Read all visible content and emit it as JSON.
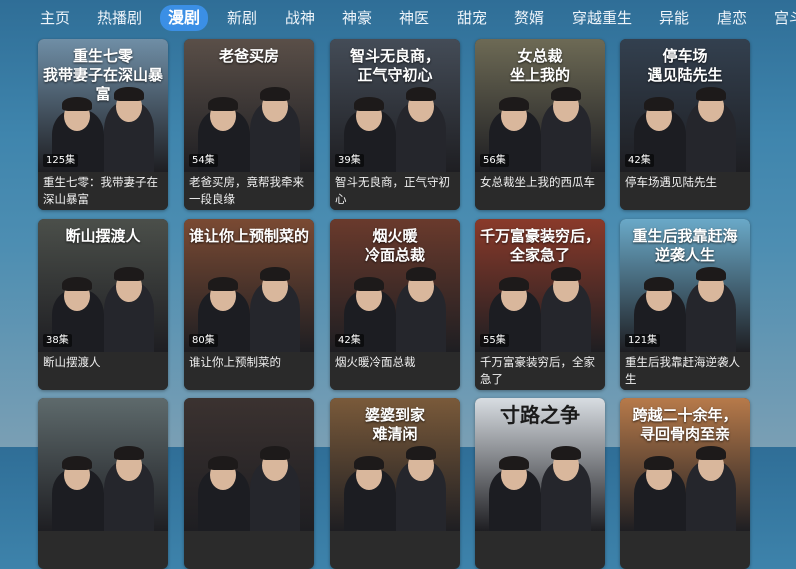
{
  "nav": {
    "tabs": [
      {
        "label": "主页",
        "active": false
      },
      {
        "label": "热播剧",
        "active": false
      },
      {
        "label": "漫剧",
        "active": true
      },
      {
        "label": "新剧",
        "active": false
      },
      {
        "label": "战神",
        "active": false
      },
      {
        "label": "神豪",
        "active": false
      },
      {
        "label": "神医",
        "active": false
      },
      {
        "label": "甜宠",
        "active": false
      },
      {
        "label": "赘婿",
        "active": false
      },
      {
        "label": "穿越重生",
        "active": false
      },
      {
        "label": "异能",
        "active": false
      },
      {
        "label": "虐恋",
        "active": false
      },
      {
        "label": "宫斗",
        "active": false
      }
    ]
  },
  "grid": {
    "rows": [
      [
        {
          "poster_title": "重生七零\n我带妻子在深山暴富",
          "episodes": "125集",
          "caption": "重生七零：我带妻子在深山暴富",
          "theme": "#6f8ea6"
        },
        {
          "poster_title": "老爸买房",
          "episodes": "54集",
          "caption": "老爸买房，竟帮我牵来一段良缘",
          "theme": "#5a4f48"
        },
        {
          "poster_title": "智斗无良商，\n正气守初心",
          "episodes": "39集",
          "caption": "智斗无良商，正气守初心",
          "theme": "#444c57"
        },
        {
          "poster_title": "女总裁\n坐上我的",
          "episodes": "56集",
          "caption": "女总裁坐上我的西瓜车",
          "theme": "#6d6a55"
        },
        {
          "poster_title": "停车场\n遇见陆先生",
          "episodes": "42集",
          "caption": "停车场遇见陆先生",
          "theme": "#33404f"
        }
      ],
      [
        {
          "poster_title": "断山摆渡人",
          "episodes": "38集",
          "caption": "断山摆渡人",
          "theme": "#4b4f4a"
        },
        {
          "poster_title": "谁让你上预制菜的",
          "episodes": "80集",
          "caption": "谁让你上预制菜的",
          "theme": "#7a4a33"
        },
        {
          "poster_title": "烟火暖\n冷面总裁",
          "episodes": "42集",
          "caption": "烟火暖冷面总裁",
          "theme": "#6a3a2c"
        },
        {
          "poster_title": "千万富豪装穷后，全家急了",
          "episodes": "55集",
          "caption": "千万富豪装穷后，全家急了",
          "theme": "#8a3a2a"
        },
        {
          "poster_title": "重生后我靠赶海\n逆袭人生",
          "episodes": "121集",
          "caption": "重生后我靠赶海逆袭人生",
          "theme": "#6aa9c8"
        }
      ],
      [
        {
          "poster_title": "",
          "episodes": "",
          "caption": "",
          "theme": "#5e6a6c"
        },
        {
          "poster_title": "",
          "episodes": "",
          "caption": "",
          "theme": "#3b3230"
        },
        {
          "poster_title": "婆婆到家\n难清闲",
          "episodes": "",
          "caption": "",
          "theme": "#7a5a3a"
        },
        {
          "poster_title": "寸路之争",
          "episodes": "",
          "caption": "",
          "theme": "#d8dde2"
        },
        {
          "poster_title": "跨越二十余年，\n寻回骨肉至亲",
          "episodes": "",
          "caption": "",
          "theme": "#b77a4a"
        }
      ]
    ]
  }
}
